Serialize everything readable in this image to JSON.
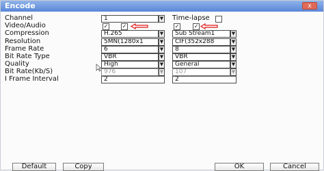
{
  "dialog": {
    "title": "Encode",
    "close_symbol": "x"
  },
  "form": {
    "channel": {
      "label": "Channel",
      "value": "1"
    },
    "timelapse": {
      "label": "Time-lapse",
      "checked": false
    },
    "video_audio": {
      "label": "Video/Audio",
      "main_video": "✓",
      "main_audio": "✓",
      "sub_video": "✓",
      "sub_audio": "✓"
    },
    "compression": {
      "label": "Compression",
      "main": "H.265",
      "sub": "Sub Stream1"
    },
    "resolution": {
      "label": "Resolution",
      "main": "5MN(1280x1",
      "sub": "CIF(352x288"
    },
    "frame_rate": {
      "label": "Frame Rate",
      "main": "6",
      "sub": "8"
    },
    "bit_rate_type": {
      "label": "Bit Rate Type",
      "main": "VBR",
      "sub": "VBR"
    },
    "quality": {
      "label": "Quality",
      "main": "High",
      "sub": "General"
    },
    "bit_rate": {
      "label": "Bit Rate(Kb/S)",
      "main": "976",
      "sub": "107"
    },
    "iframe": {
      "label": "I Frame Interval",
      "main": "2",
      "sub": "2"
    }
  },
  "buttons": {
    "default": "Default",
    "copy": "Copy",
    "ok": "OK",
    "cancel": "Cancel"
  },
  "colors": {
    "title_bar": "#6d93dc",
    "close": "#e06a58",
    "annotation_arrow": "#e01818"
  }
}
